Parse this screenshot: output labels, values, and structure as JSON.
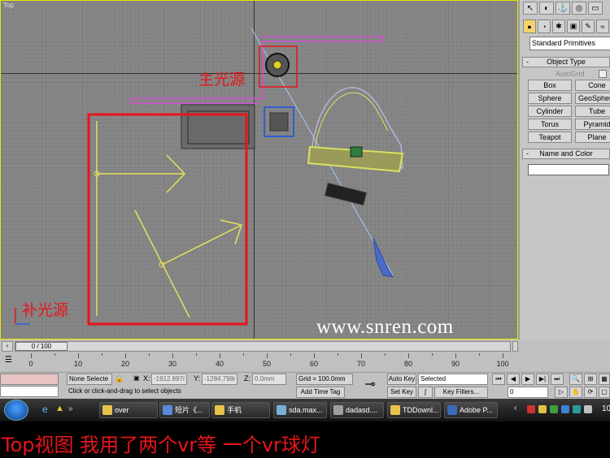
{
  "viewport": {
    "label": "Top",
    "annotation_main_light": "主光源",
    "annotation_fill_light": "补光源",
    "watermark": "www.snren.com"
  },
  "command_panel": {
    "primitive_type": "Standard Primitives",
    "object_type_title": "Object Type",
    "autogrid_label": "AutoGrid",
    "buttons": [
      "Box",
      "Cone",
      "Sphere",
      "GeoSphere",
      "Cylinder",
      "Tube",
      "Torus",
      "Pyramid",
      "Teapot",
      "Plane"
    ],
    "name_color_title": "Name and Color",
    "accent_color": "#f5d36d"
  },
  "timeline": {
    "frame_label": "0 / 100",
    "ticks": [
      "0",
      "10",
      "20",
      "30",
      "40",
      "50",
      "60",
      "70",
      "80",
      "90",
      "100"
    ]
  },
  "statusbar": {
    "selection": "None Selecte",
    "x_label": "X:",
    "x_value": "-1912.897r",
    "y_label": "Y:",
    "y_value": "-1284.798r",
    "z_label": "Z:",
    "z_value": "0.0mm",
    "grid": "Grid = 100.0mm",
    "prompt": "Click or click-and-drag to select objects",
    "add_time_tag": "Add Time Tag",
    "auto_key": "Auto Key",
    "set_key": "Set Key",
    "key_mode": "Selected",
    "key_filters": "Key Filters...",
    "frame": "0"
  },
  "taskbar": {
    "items": [
      "over",
      "短片《...",
      "手机",
      "sda.max...",
      "dadasd....",
      "TDDownl...",
      "Adobe P..."
    ],
    "clock": "10"
  },
  "caption": "Top视图  我用了两个vr等  一个vr球灯"
}
